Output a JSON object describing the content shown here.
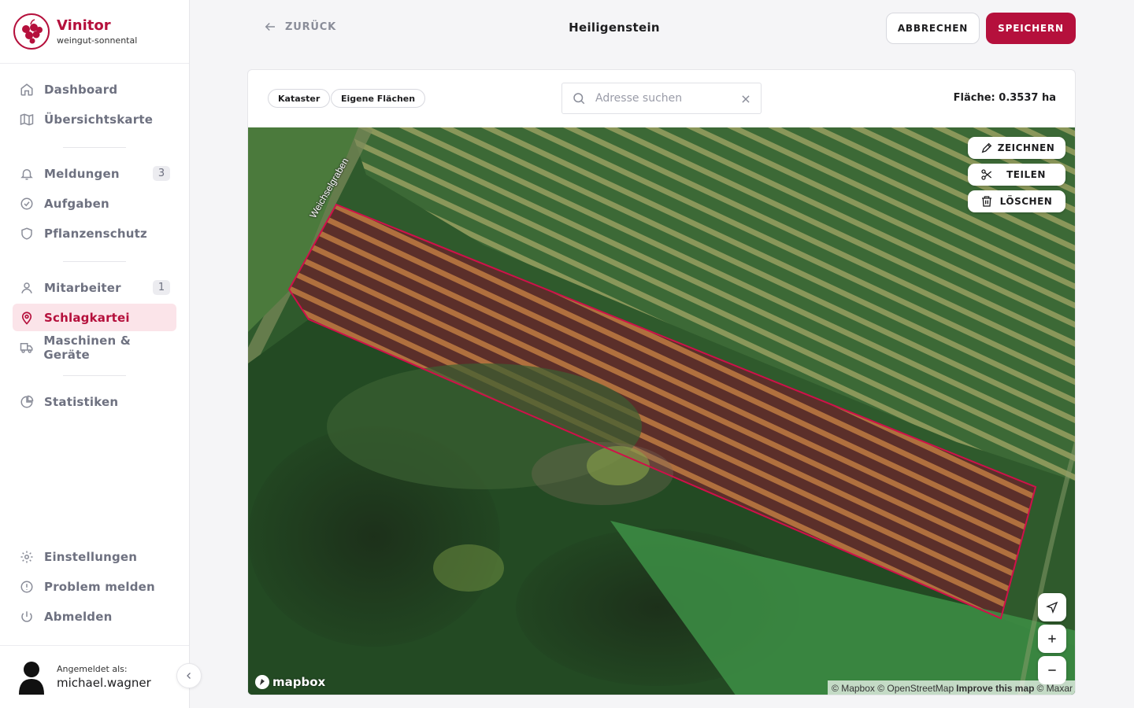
{
  "brand": {
    "name": "Vinitor",
    "subtitle": "weingut-sonnental"
  },
  "nav": {
    "group1": [
      {
        "label": "Dashboard",
        "icon": "home-icon"
      },
      {
        "label": "Übersichtskarte",
        "icon": "map-icon"
      }
    ],
    "group2": [
      {
        "label": "Meldungen",
        "icon": "bell-icon",
        "badge": "3"
      },
      {
        "label": "Aufgaben",
        "icon": "check-circle-icon"
      },
      {
        "label": "Pflanzenschutz",
        "icon": "shield-icon"
      }
    ],
    "group3": [
      {
        "label": "Mitarbeiter",
        "icon": "user-icon",
        "badge": "1"
      },
      {
        "label": "Schlagkartei",
        "icon": "map-pin-icon",
        "active": true
      },
      {
        "label": "Maschinen & Geräte",
        "icon": "truck-icon"
      }
    ],
    "group4": [
      {
        "label": "Statistiken",
        "icon": "pie-chart-icon"
      }
    ],
    "bottom": [
      {
        "label": "Einstellungen",
        "icon": "gear-icon"
      },
      {
        "label": "Problem melden",
        "icon": "alert-circle-icon"
      },
      {
        "label": "Abmelden",
        "icon": "power-icon"
      }
    ]
  },
  "user": {
    "label": "Angemeldet als:",
    "name": "michael.wagner"
  },
  "topbar": {
    "back_label": "ZURÜCK",
    "title": "Heiligenstein",
    "cancel_label": "ABBRECHEN",
    "save_label": "SPEICHERN"
  },
  "toolbar": {
    "chips": [
      "Kataster",
      "Eigene Flächen"
    ],
    "search_placeholder": "Adresse suchen",
    "search_value": "",
    "area_text": "Fläche: 0.3537 ha"
  },
  "map": {
    "road_label": "Weichselgraben",
    "tools": {
      "draw": "ZEICHNEN",
      "split": "TEILEN",
      "delete": "LÖSCHEN"
    },
    "logo_text": "mapbox",
    "attribution": {
      "mapbox": "© Mapbox",
      "osm": "© OpenStreetMap",
      "improve": "Improve this map",
      "maxar": "© Maxar"
    },
    "polygon_color": "#d0104a"
  },
  "colors": {
    "accent": "#b5103c",
    "active_bg": "#fbe4e9"
  }
}
